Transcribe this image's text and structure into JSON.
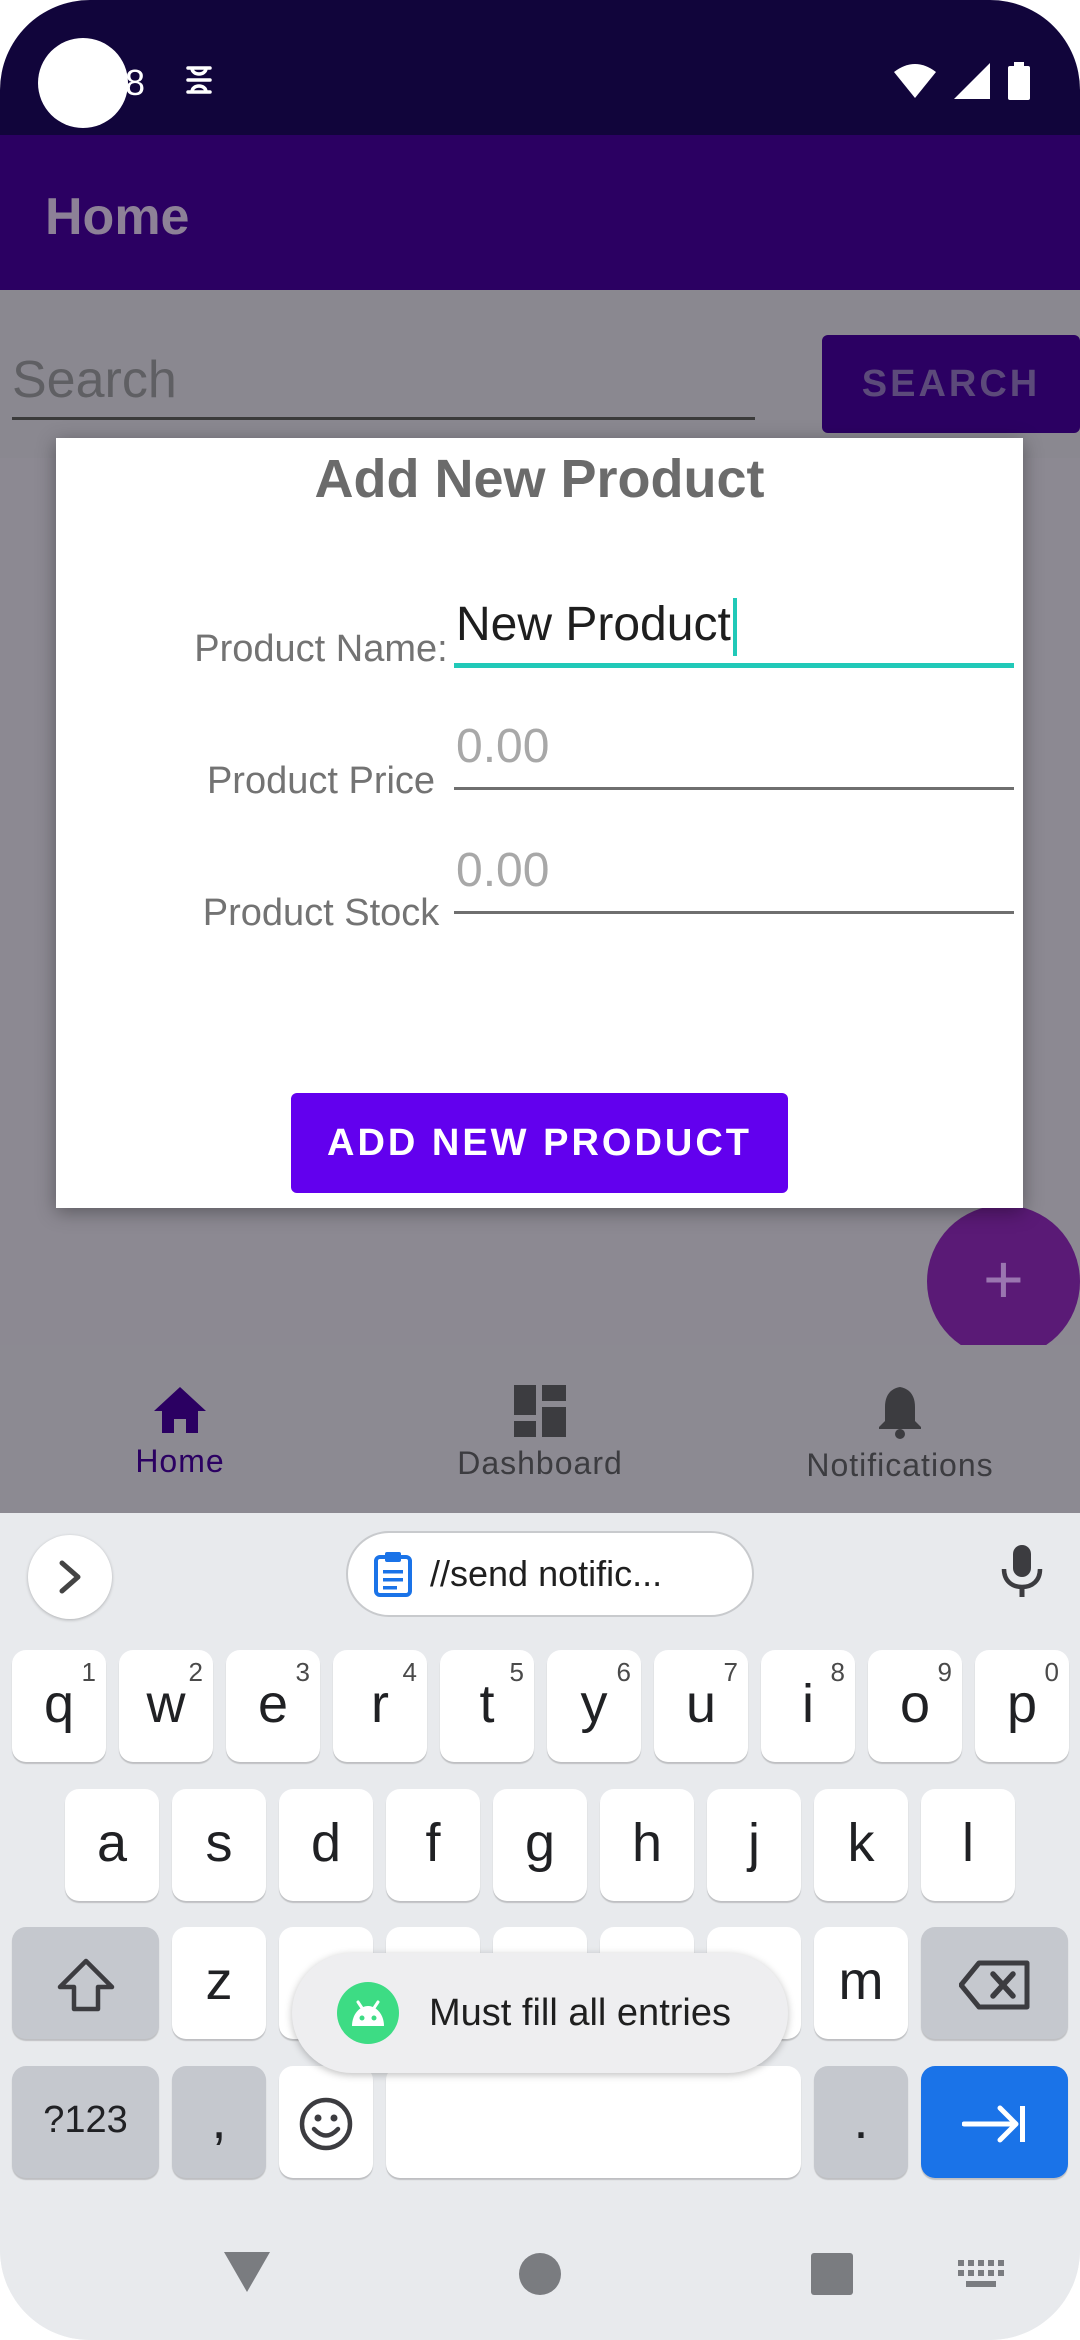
{
  "status_bar": {
    "notification_count": "8"
  },
  "app_bar": {
    "title": "Home"
  },
  "search": {
    "placeholder": "Search",
    "button_label": "SEARCH"
  },
  "dialog": {
    "title": "Add New Product",
    "fields": [
      {
        "label": "Product Name:",
        "value": "New Product"
      },
      {
        "label": "Product Price",
        "placeholder": "0.00"
      },
      {
        "label": "Product Stock",
        "placeholder": "0.00"
      }
    ],
    "submit_label": "ADD NEW PRODUCT"
  },
  "fab": {
    "icon": "+"
  },
  "bottom_nav": {
    "items": [
      {
        "label": "Home",
        "icon": "home-icon",
        "active": true
      },
      {
        "label": "Dashboard",
        "icon": "dashboard-icon",
        "active": false
      },
      {
        "label": "Notifications",
        "icon": "bell-icon",
        "active": false
      }
    ]
  },
  "keyboard": {
    "clipboard_suggestion": "//send notific...",
    "row1": [
      {
        "key": "q",
        "hint": "1"
      },
      {
        "key": "w",
        "hint": "2"
      },
      {
        "key": "e",
        "hint": "3"
      },
      {
        "key": "r",
        "hint": "4"
      },
      {
        "key": "t",
        "hint": "5"
      },
      {
        "key": "y",
        "hint": "6"
      },
      {
        "key": "u",
        "hint": "7"
      },
      {
        "key": "i",
        "hint": "8"
      },
      {
        "key": "o",
        "hint": "9"
      },
      {
        "key": "p",
        "hint": "0"
      }
    ],
    "row2": [
      "a",
      "s",
      "d",
      "f",
      "g",
      "h",
      "j",
      "k",
      "l"
    ],
    "row3_left": "z",
    "row3_right": "m",
    "symbols_label": "?123",
    "comma": ",",
    "period": "."
  },
  "toast": {
    "message": "Must fill all entries"
  },
  "colors": {
    "primary": "#6200ee",
    "primary_dark": "#2b0062",
    "accent": "#21c9b8",
    "keyboard_enter": "#1a73e8"
  }
}
